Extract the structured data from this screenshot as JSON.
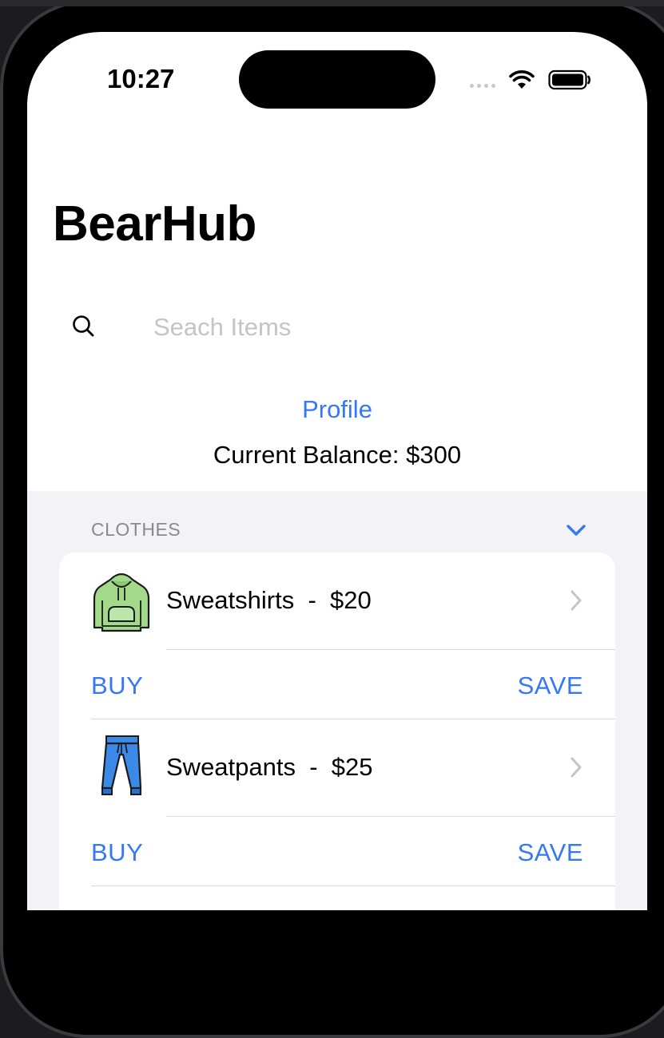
{
  "status_bar": {
    "time": "10:27"
  },
  "app": {
    "title": "BearHub"
  },
  "search": {
    "placeholder": "Seach Items",
    "value": ""
  },
  "profile": {
    "link_label": "Profile",
    "balance_text": "Current Balance: $300"
  },
  "section": {
    "header": "CLOTHES",
    "expanded": true
  },
  "items": [
    {
      "label": "Sweatshirts  -  $20",
      "icon": "green-hoodie-icon",
      "buy_label": "BUY",
      "save_label": "SAVE"
    },
    {
      "label": "Sweatpants  -  $25",
      "icon": "blue-sweatpants-icon",
      "buy_label": "BUY",
      "save_label": "SAVE"
    }
  ],
  "colors": {
    "accent": "#3478f6",
    "grouped_background": "#f2f2f7",
    "secondary_text": "#8a8a8e",
    "hoodie": "#a3d98b",
    "pants": "#3c8ae8"
  }
}
